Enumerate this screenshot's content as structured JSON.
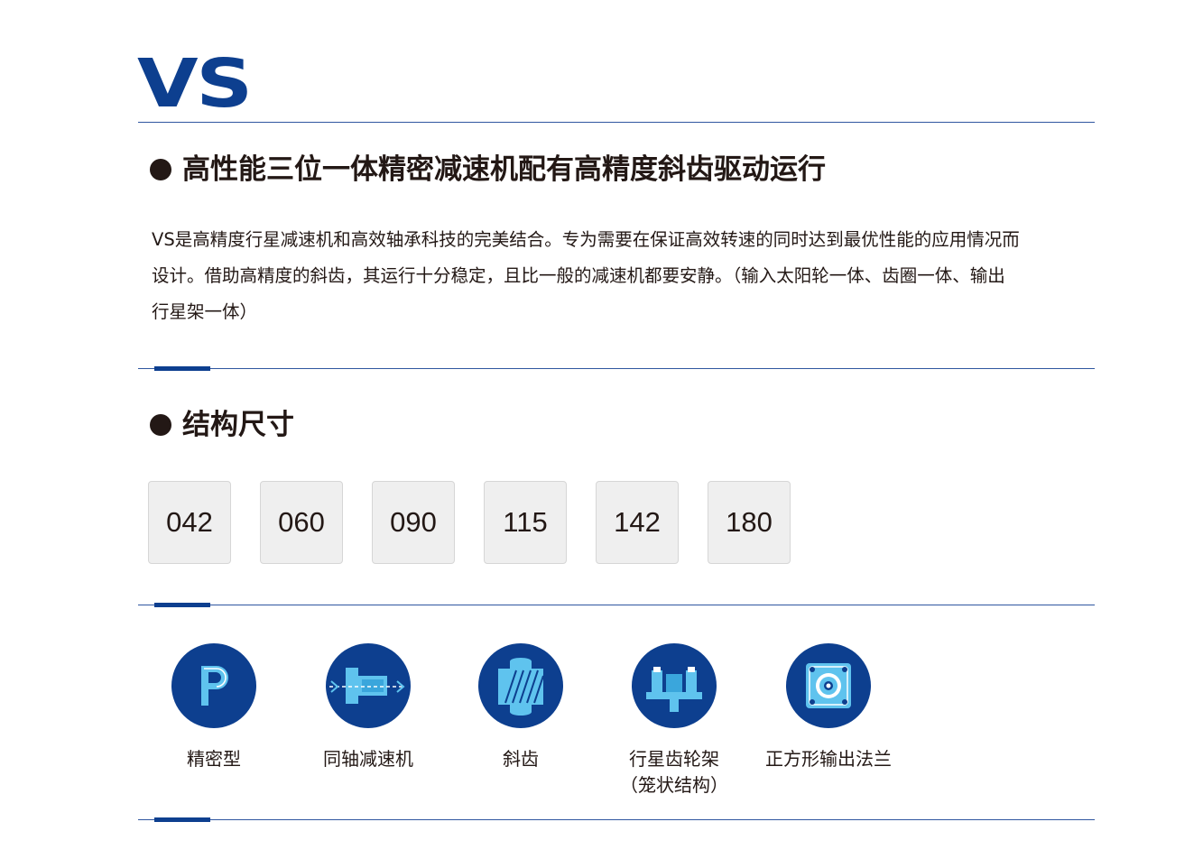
{
  "brand": {
    "logo_text": "VS",
    "color": "#0d3f8f"
  },
  "section1": {
    "heading": "高性能三位一体精密减速机配有高精度斜齿驱动运行",
    "intro_lines": [
      "VS是高精度行星减速机和高效轴承科技的完美结合。专为需要在保证高效转速的同时达到最优性能的应用情况而",
      "设计。借助高精度的斜齿，其运行十分稳定，且比一般的减速机都要安静。（输入太阳轮一体、齿圈一体、输出",
      "行星架一体）"
    ]
  },
  "section2": {
    "heading": "结构尺寸",
    "sizes": [
      "042",
      "060",
      "090",
      "115",
      "142",
      "180"
    ]
  },
  "features": [
    {
      "icon": "precision-p-icon",
      "label_lines": [
        "精密型"
      ]
    },
    {
      "icon": "coaxial-shaft-icon",
      "label_lines": [
        "同轴减速机"
      ]
    },
    {
      "icon": "helical-gear-icon",
      "label_lines": [
        "斜齿"
      ]
    },
    {
      "icon": "planet-carrier-icon",
      "label_lines": [
        "行星齿轮架",
        "（笼状结构）"
      ]
    },
    {
      "icon": "square-flange-icon",
      "label_lines": [
        "正方形输出法兰"
      ]
    }
  ]
}
